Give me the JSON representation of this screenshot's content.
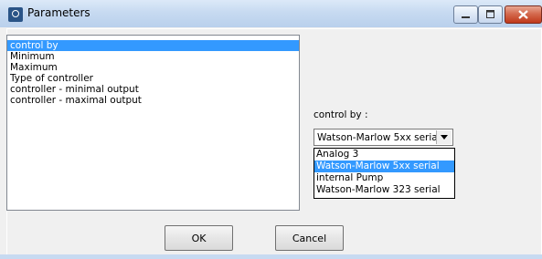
{
  "window": {
    "title": "Parameters"
  },
  "parameters_list": {
    "items": [
      {
        "label": "control by",
        "selected": true
      },
      {
        "label": "Minimum",
        "selected": false
      },
      {
        "label": "Maximum",
        "selected": false
      },
      {
        "label": "Type of controller",
        "selected": false
      },
      {
        "label": "controller - minimal output",
        "selected": false
      },
      {
        "label": "controller - maximal output",
        "selected": false
      }
    ]
  },
  "control_by": {
    "label": "control by :",
    "selected_value": "Watson-Marlow 5xx serial",
    "options": [
      {
        "label": "Analog 3",
        "selected": false
      },
      {
        "label": "Watson-Marlow 5xx serial",
        "selected": true
      },
      {
        "label": "internal Pump",
        "selected": false
      },
      {
        "label": "Watson-Marlow 323 serial",
        "selected": false
      }
    ]
  },
  "buttons": {
    "ok": "OK",
    "cancel": "Cancel"
  },
  "colors": {
    "selection": "#3399ff",
    "titlebar": "#c7daf1",
    "close_button": "#c0381a"
  }
}
